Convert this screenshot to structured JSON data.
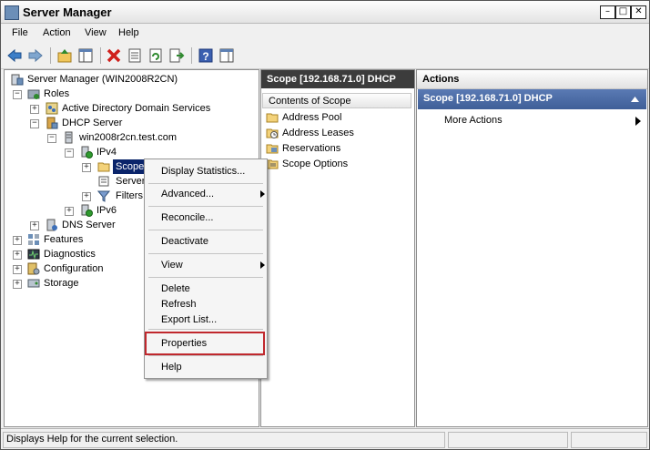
{
  "window": {
    "title": "Server Manager"
  },
  "menubar": {
    "file": "File",
    "action": "Action",
    "view": "View",
    "help": "Help"
  },
  "tree": {
    "root": "Server Manager (WIN2008R2CN)",
    "roles": "Roles",
    "adds": "Active Directory Domain Services",
    "dhcp": "DHCP Server",
    "host": "win2008r2cn.test.com",
    "ipv4": "IPv4",
    "scope": "Scope",
    "server": "Server",
    "filters": "Filters",
    "ipv6": "IPv6",
    "dns": "DNS Server",
    "features": "Features",
    "diagnostics": "Diagnostics",
    "configuration": "Configuration",
    "storage": "Storage"
  },
  "center": {
    "header": "Scope [192.168.71.0] DHCP",
    "column": "Contents of Scope",
    "items": [
      "Address Pool",
      "Address Leases",
      "Reservations",
      "Scope Options"
    ]
  },
  "actions": {
    "header": "Actions",
    "section": "Scope [192.168.71.0] DHCP",
    "more": "More Actions"
  },
  "context_menu": {
    "display_stats": "Display Statistics...",
    "advanced": "Advanced...",
    "reconcile": "Reconcile...",
    "deactivate": "Deactivate",
    "view": "View",
    "delete": "Delete",
    "refresh": "Refresh",
    "export": "Export List...",
    "properties": "Properties",
    "help": "Help"
  },
  "status": {
    "text": "Displays Help for the current selection."
  },
  "colors": {
    "selection": "#0a246a",
    "highlight_box": "#c0282d",
    "actions_bar": "#3f5f98"
  }
}
